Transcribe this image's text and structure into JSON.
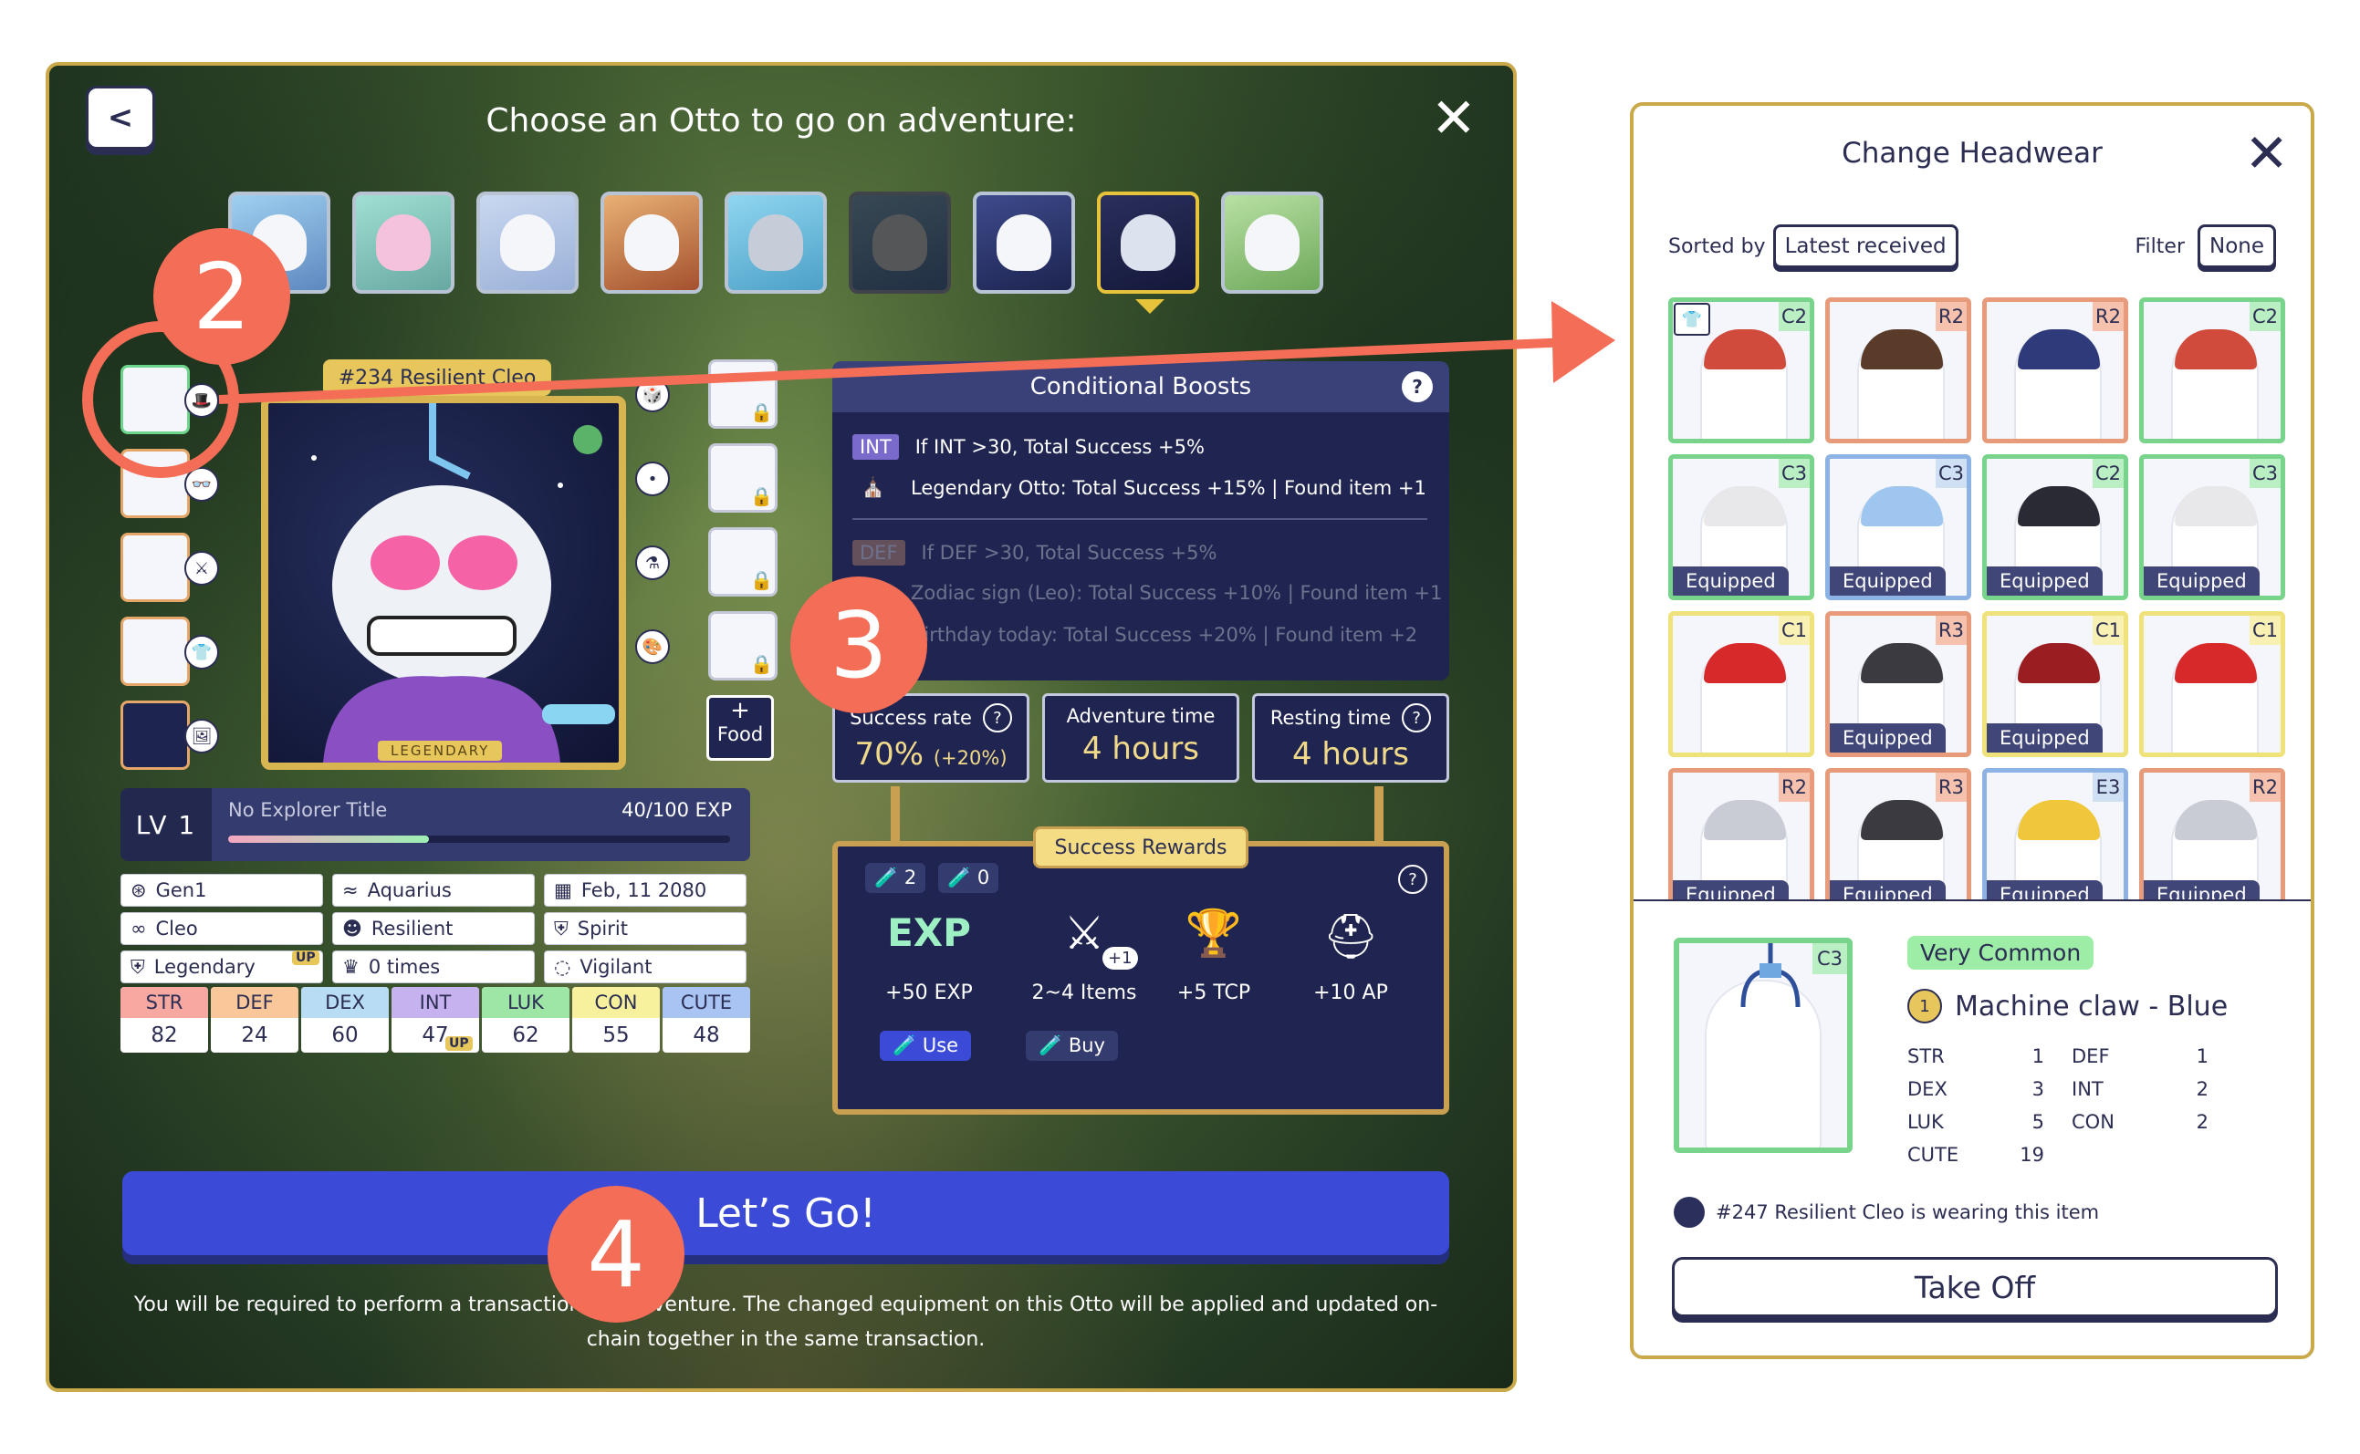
{
  "game": {
    "title": "Choose an Otto to go on adventure:",
    "back_label": "<",
    "close_label": "✕",
    "nft_name": "#234 Resilient Cleo",
    "nft_rarity_label": "LEGENDARY",
    "food_plus": "+",
    "food_label": "Food",
    "level": "LV 1",
    "explorer_title": "No Explorer Title",
    "exp": "40/100 EXP",
    "exp_progress": 0.4,
    "info": [
      "Gen1",
      "Aquarius",
      "Feb, 11 2080",
      "Cleo",
      "Resilient",
      "Spirit",
      "Legendary",
      "0 times",
      "Vigilant"
    ],
    "up_label": "UP",
    "stats": [
      {
        "name": "STR",
        "value": "82",
        "color": "#f7a8a0"
      },
      {
        "name": "DEF",
        "value": "24",
        "color": "#f9c79a"
      },
      {
        "name": "DEX",
        "value": "60",
        "color": "#b8dcf4"
      },
      {
        "name": "INT",
        "value": "47",
        "color": "#c7b2f0"
      },
      {
        "name": "LUK",
        "value": "62",
        "color": "#9ee6a6"
      },
      {
        "name": "CON",
        "value": "55",
        "color": "#f7f19e"
      },
      {
        "name": "CUTE",
        "value": "48",
        "color": "#a9c4f2"
      }
    ],
    "boost": {
      "title": "Conditional Boosts",
      "q": "?",
      "active": [
        {
          "tag": "INT",
          "text": "If INT >30, Total Success +5%"
        },
        {
          "tag": "",
          "text": "Legendary Otto: Total Success +15% | Found item +1"
        }
      ],
      "inactive": [
        {
          "tag": "DEF",
          "text": "If DEF >30, Total Success +5%"
        },
        {
          "tag": "",
          "text": "Zodiac sign (Leo): Total Success +10% | Found item +1"
        },
        {
          "tag": "",
          "text": "Birthday today: Total Success +20% | Found item +2"
        }
      ]
    },
    "success_rate_label": "Success rate",
    "success_rate_value": "70%",
    "success_rate_bonus": "(+20%)",
    "adventure_time_label": "Adventure time",
    "adventure_time_value": "4 hours",
    "resting_time_label": "Resting time",
    "resting_time_value": "4 hours",
    "rewards": {
      "title": "Success Rewards",
      "potion_a": "2",
      "potion_b": "0",
      "exp_icon": "EXP",
      "plus_one": "+1",
      "items": [
        "+50 EXP",
        "2~4 Items",
        "+5 TCP",
        "+10 AP"
      ],
      "use_label": "Use",
      "buy_label": "Buy"
    },
    "go_label": "Let’s Go!",
    "note": "You will be required to perform a transaction per adventure. The changed equipment on this Otto will be applied and updated on-chain together in the same transaction."
  },
  "callouts": [
    "2",
    "3",
    "4"
  ],
  "headwear": {
    "title": "Change Headwear",
    "close_label": "✕",
    "sorted_label": "Sorted by",
    "sorted_value": "Latest received",
    "filter_label": "Filter",
    "filter_value": "None",
    "items": [
      {
        "rarity": "C2",
        "color": "g",
        "hat": "#d14b3c",
        "equipped": ""
      },
      {
        "rarity": "R2",
        "color": "r",
        "hat": "#5a3b2a",
        "equipped": ""
      },
      {
        "rarity": "R2",
        "color": "r",
        "hat": "#2e3a7a",
        "equipped": ""
      },
      {
        "rarity": "C2",
        "color": "g",
        "hat": "#d14b3c",
        "equipped": ""
      },
      {
        "rarity": "C3",
        "color": "g",
        "hat": "#e8e8ea",
        "equipped": "Equipped"
      },
      {
        "rarity": "C3",
        "color": "b",
        "hat": "#9ec6ee",
        "equipped": "Equipped"
      },
      {
        "rarity": "C2",
        "color": "g",
        "hat": "#2a2a35",
        "equipped": "Equipped"
      },
      {
        "rarity": "C3",
        "color": "g",
        "hat": "#e8e8ea",
        "equipped": "Equipped"
      },
      {
        "rarity": "C1",
        "color": "y",
        "hat": "#d7282a",
        "equipped": ""
      },
      {
        "rarity": "R3",
        "color": "r",
        "hat": "#3a3a40",
        "equipped": "Equipped"
      },
      {
        "rarity": "C1",
        "color": "y",
        "hat": "#9a1d22",
        "equipped": "Equipped"
      },
      {
        "rarity": "C1",
        "color": "y",
        "hat": "#d7282a",
        "equipped": ""
      },
      {
        "rarity": "R2",
        "color": "r",
        "hat": "#c9ccd4",
        "equipped": "Equipped"
      },
      {
        "rarity": "R3",
        "color": "r",
        "hat": "#3a3a40",
        "equipped": "Equipped"
      },
      {
        "rarity": "E3",
        "color": "b",
        "hat": "#f0c63a",
        "equipped": "Equipped"
      },
      {
        "rarity": "R2",
        "color": "r",
        "hat": "#c9ccd4",
        "equipped": "Equipped"
      }
    ],
    "detail": {
      "rarity_code": "C3",
      "badge": "Very Common",
      "name": "Machine claw - Blue",
      "level": "1",
      "stats": [
        {
          "k": "STR",
          "v": "1"
        },
        {
          "k": "DEF",
          "v": "1"
        },
        {
          "k": "DEX",
          "v": "3"
        },
        {
          "k": "INT",
          "v": "2"
        },
        {
          "k": "LUK",
          "v": "5"
        },
        {
          "k": "CON",
          "v": "2"
        },
        {
          "k": "CUTE",
          "v": "19"
        }
      ],
      "wearer": "#247 Resilient Cleo is wearing this item"
    },
    "take_off_label": "Take Off"
  }
}
